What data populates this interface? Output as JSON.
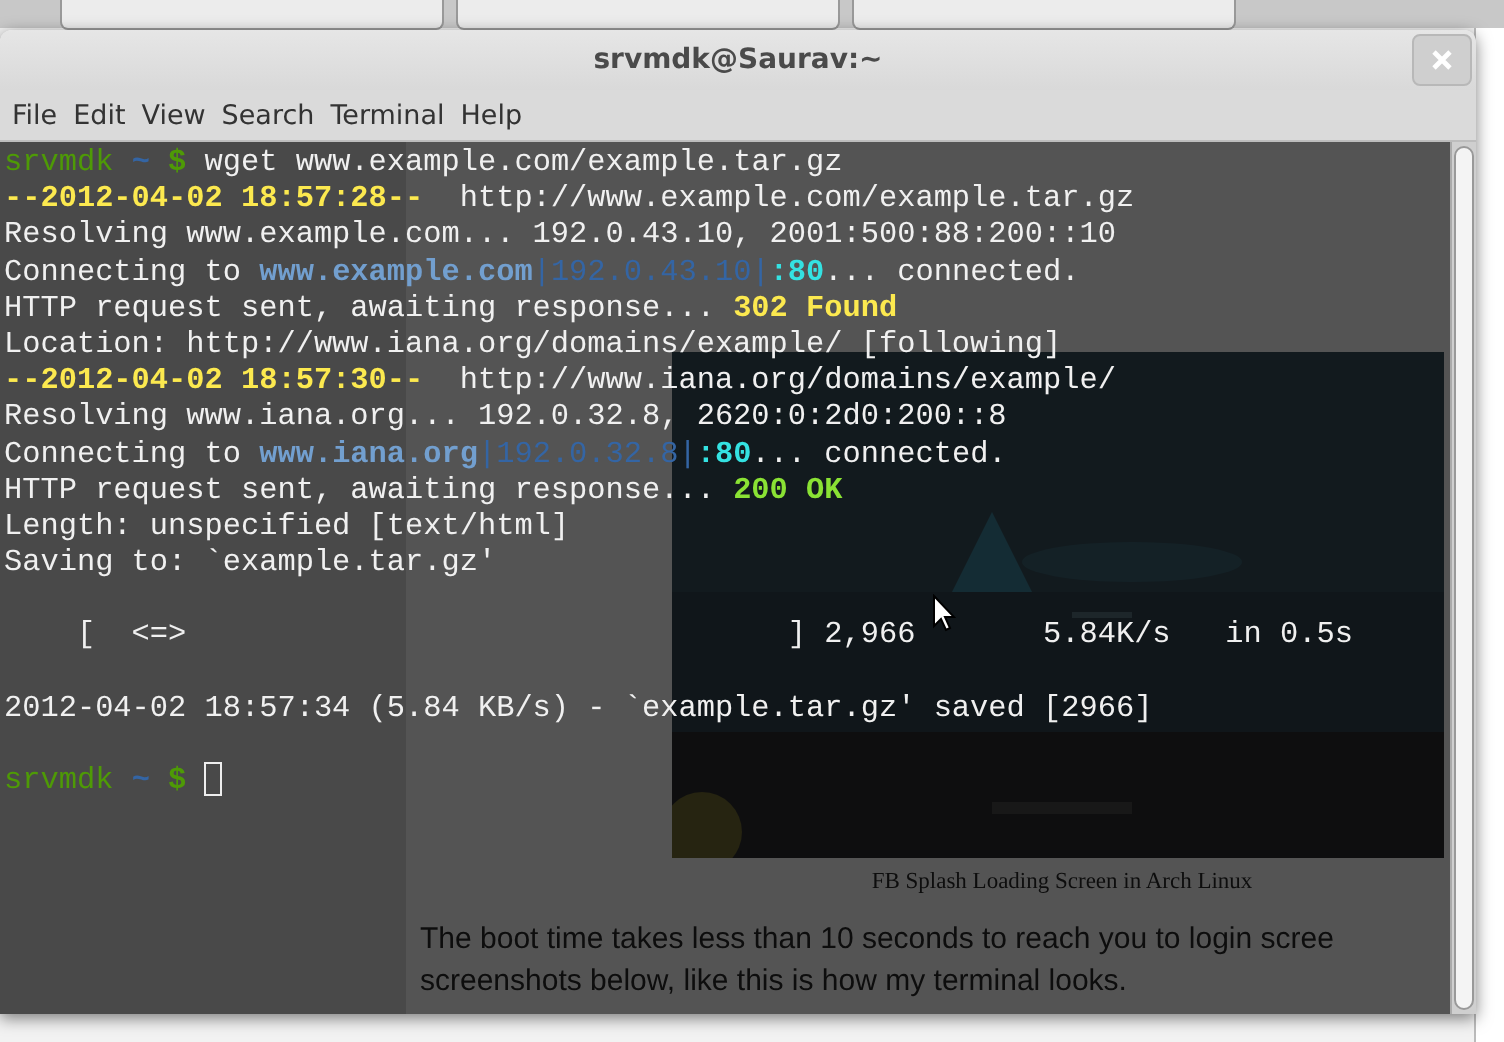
{
  "window": {
    "title": "srvmdk@Saurav:~"
  },
  "menu": [
    "File",
    "Edit",
    "View",
    "Search",
    "Terminal",
    "Help"
  ],
  "terminal_lines": [
    {
      "kind": "text",
      "segments": [
        {
          "kind": "user",
          "text": "srvmdk "
        },
        {
          "kind": "path",
          "text": "~ "
        },
        {
          "kind": "dollar",
          "text": "$ "
        },
        {
          "kind": "plain",
          "text": "wget www.example.com/example.tar.gz"
        }
      ]
    },
    {
      "kind": "text",
      "segments": [
        {
          "kind": "date",
          "text": "--2012-04-02 18:57:28--"
        },
        {
          "kind": "plain",
          "text": "  http://www.example.com/example.tar.gz"
        }
      ]
    },
    {
      "kind": "text",
      "segments": [
        {
          "kind": "plain",
          "text": "Resolving www.example.com... 192.0.43.10, 2001:500:88:200::10"
        }
      ]
    },
    {
      "kind": "text",
      "segments": [
        {
          "kind": "plain",
          "text": "Connecting to "
        },
        {
          "kind": "host",
          "text": "www.example.com"
        },
        {
          "kind": "ip",
          "text": "|192.0.43.10|"
        },
        {
          "kind": "port",
          "text": ":80"
        },
        {
          "kind": "plain",
          "text": "... connected."
        }
      ]
    },
    {
      "kind": "text",
      "segments": [
        {
          "kind": "plain",
          "text": "HTTP request sent, awaiting response... "
        },
        {
          "kind": "warn",
          "text": "302 Found"
        }
      ]
    },
    {
      "kind": "text",
      "segments": [
        {
          "kind": "plain",
          "text": "Location: http://www.iana.org/domains/example/ [following]"
        }
      ]
    },
    {
      "kind": "text",
      "segments": [
        {
          "kind": "date",
          "text": "--2012-04-02 18:57:30--"
        },
        {
          "kind": "plain",
          "text": "  http://www.iana.org/domains/example/"
        }
      ]
    },
    {
      "kind": "text",
      "segments": [
        {
          "kind": "plain",
          "text": "Resolving www.iana.org... 192.0.32.8, 2620:0:2d0:200::8"
        }
      ]
    },
    {
      "kind": "text",
      "segments": [
        {
          "kind": "plain",
          "text": "Connecting to "
        },
        {
          "kind": "host",
          "text": "www.iana.org"
        },
        {
          "kind": "ip",
          "text": "|192.0.32.8|"
        },
        {
          "kind": "port",
          "text": ":80"
        },
        {
          "kind": "plain",
          "text": "... connected."
        }
      ]
    },
    {
      "kind": "text",
      "segments": [
        {
          "kind": "plain",
          "text": "HTTP request sent, awaiting response... "
        },
        {
          "kind": "ok",
          "text": "200 OK"
        }
      ]
    },
    {
      "kind": "text",
      "segments": [
        {
          "kind": "plain",
          "text": "Length: unspecified [text/html]"
        }
      ]
    },
    {
      "kind": "text",
      "segments": [
        {
          "kind": "plain",
          "text": "Saving to: `example.tar.gz'"
        }
      ]
    },
    {
      "kind": "blank"
    },
    {
      "kind": "text",
      "segments": [
        {
          "kind": "plain",
          "text": "    [  <=>                                 ] 2,966       5.84K/s   in 0.5s"
        }
      ]
    },
    {
      "kind": "blank"
    },
    {
      "kind": "text",
      "segments": [
        {
          "kind": "plain",
          "text": "2012-04-02 18:57:34 (5.84 KB/s) - `example.tar.gz' saved [2966]"
        }
      ]
    },
    {
      "kind": "blank"
    },
    {
      "kind": "prompt",
      "cursor": true,
      "segments": [
        {
          "kind": "user",
          "text": "srvmdk "
        },
        {
          "kind": "path",
          "text": "~ "
        },
        {
          "kind": "dollar",
          "text": "$ "
        }
      ]
    }
  ],
  "background_page": {
    "caption": "FB Splash Loading Screen in Arch Linux",
    "paragraph_lines": [
      "The boot time takes less than 10 seconds to reach you to login scree",
      "screenshots below, like this is how my terminal looks."
    ]
  }
}
